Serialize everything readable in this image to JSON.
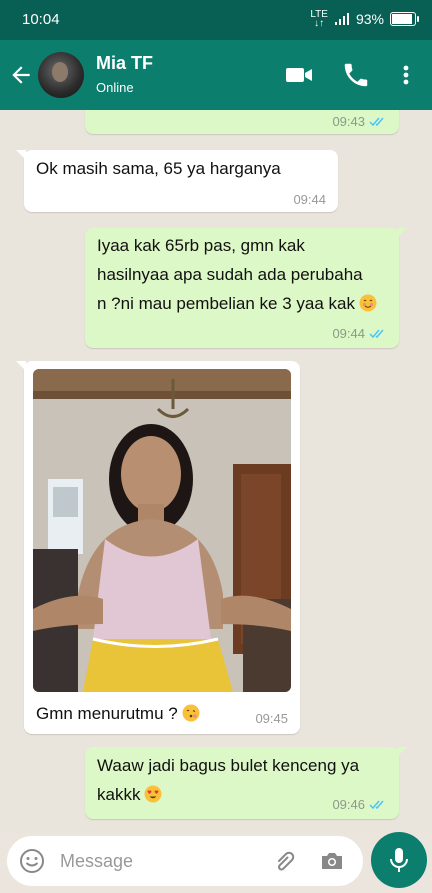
{
  "status_bar": {
    "time": "10:04",
    "network": "LTE",
    "battery": "93%",
    "battery_level": 0.93
  },
  "header": {
    "contact_name": "Mia TF",
    "presence": "Online"
  },
  "messages": [
    {
      "direction": "out",
      "text": "",
      "time": "09:43",
      "status": "read"
    },
    {
      "direction": "in",
      "text": "Ok masih sama, 65 ya harganya",
      "time": "09:44"
    },
    {
      "direction": "out",
      "lines": [
        "Iyaa kak 65rb pas, gmn kak",
        "hasilnyaa apa sudah ada perubaha",
        "n ?ni mau pembelian ke 3 yaa kak"
      ],
      "emoji": "smiling-face-icon",
      "time": "09:44",
      "status": "read"
    },
    {
      "direction": "in",
      "type": "photo",
      "caption": "Gmn menurutmu ?",
      "emoji": "face-blowing-kiss-icon",
      "time": "09:45"
    },
    {
      "direction": "out",
      "lines": [
        "Waaw jadi bagus bulet kenceng ya",
        "kakkk"
      ],
      "emoji": "heart-eyes-icon",
      "time": "09:46",
      "status": "read"
    }
  ],
  "composer": {
    "placeholder": "Message"
  },
  "colors": {
    "header": "#0c7e6e",
    "status_bar": "#085f54",
    "outgoing_bubble": "#dcf8c6",
    "incoming_bubble": "#ffffff",
    "read_tick": "#4fc3f7"
  }
}
